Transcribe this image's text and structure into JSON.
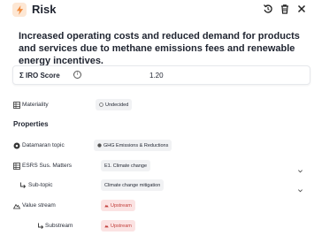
{
  "header": {
    "title": "Risk",
    "icon": "flash-icon",
    "accent": "#f08a3c"
  },
  "description": "Increased operating costs and reduced demand for products and services due to methane emissions fees and renewable energy incentives.",
  "iro_score": {
    "label": "Σ IRO Score",
    "value": "1.20"
  },
  "materiality": {
    "label": "Materiality",
    "value": "Undecided"
  },
  "properties": {
    "title": "Properties",
    "datamaran_topic": {
      "label": "Datamaran topic",
      "value": "GHG Emissions & Reductions"
    },
    "esrs": {
      "label": "ESRS Sus. Matters",
      "value": "E1. Climate change"
    },
    "sub_topic": {
      "label": "Sub-topic",
      "value": "Climate change mitigation"
    },
    "value_stream": {
      "label": "Value stream",
      "value": "Upstream"
    },
    "substream": {
      "label": "Substream",
      "value": "Upstream"
    }
  },
  "colors": {
    "chip_red_bg": "#fbe3e3",
    "chip_red_text": "#c2413d",
    "chip_gray_bg": "#f1f2f4"
  }
}
